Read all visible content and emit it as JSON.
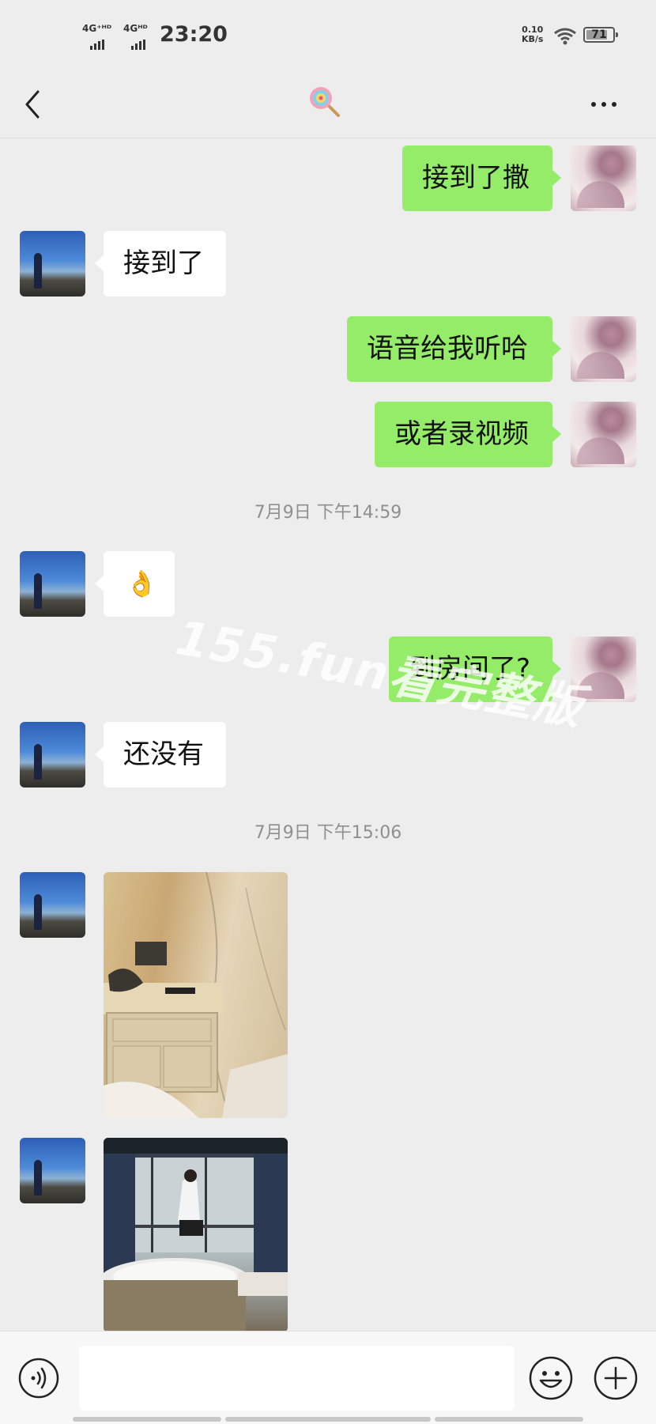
{
  "status_bar": {
    "network1": "4G⁺ᴴᴰ",
    "network2": "4Gᴴᴰ",
    "time": "23:20",
    "net_speed_value": "0.10",
    "net_speed_unit": "KB/s",
    "battery": "71"
  },
  "header": {
    "title_icon": "lollipop-icon",
    "back_icon": "chevron-left-icon",
    "more_icon": "more-dots-icon"
  },
  "messages": [
    {
      "side": "me",
      "text": "接到了撒"
    },
    {
      "side": "other",
      "text": "接到了"
    },
    {
      "side": "me",
      "text": "语音给我听哈"
    },
    {
      "side": "me",
      "text": "或者录视频"
    },
    {
      "timestamp": "7月9日 下午14:59"
    },
    {
      "side": "other",
      "emoji": "👌"
    },
    {
      "side": "me",
      "text": "到房间了?"
    },
    {
      "side": "other",
      "text": "还没有"
    },
    {
      "timestamp": "7月9日 下午15:06"
    },
    {
      "side": "other",
      "image": "bedside-table-photo"
    },
    {
      "side": "other",
      "image": "hotel-room-window-photo"
    }
  ],
  "watermark": "155.fun看完整版",
  "composer": {
    "voice_icon": "voice-icon",
    "input_value": "",
    "emoji_icon": "emoji-face-icon",
    "plus_icon": "plus-icon"
  },
  "colors": {
    "background": "#ededed",
    "my_bubble": "#95ec69",
    "other_bubble": "#ffffff"
  }
}
